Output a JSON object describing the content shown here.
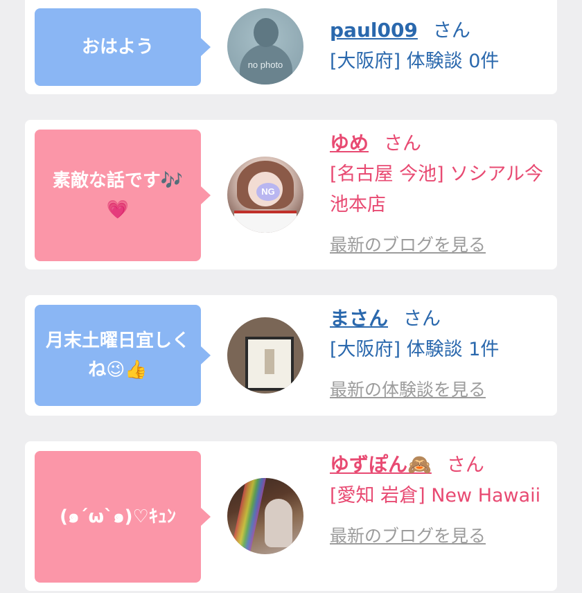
{
  "posts": [
    {
      "message": "おはよう",
      "user": "paul009",
      "suffix": "さん",
      "detail": "[大阪府] 体験談 0件",
      "link": "",
      "avatar_text": "no photo",
      "theme": "blue"
    },
    {
      "message": "素敵な話です🎶💗",
      "user": "ゆめ",
      "suffix": "さん",
      "detail": "[名古屋 今池] ソシアル今池本店",
      "link": "最新のブログを見る",
      "avatar_text": "NG",
      "theme": "pink"
    },
    {
      "message": "月末土曜日宜しくね😉👍",
      "user": "まさん",
      "suffix": "さん",
      "detail": "[大阪府] 体験談 1件",
      "link": "最新の体験談を見る",
      "avatar_text": "",
      "theme": "blue"
    },
    {
      "message": "(๑´ω`๑)♡ｷｭﾝ",
      "user": "ゆずぽん🙈",
      "suffix": "さん",
      "detail": "[愛知 岩倉] New Hawaii",
      "link": "最新のブログを見る",
      "avatar_text": "",
      "theme": "pink"
    }
  ],
  "colors": {
    "blue_bubble": "#8ab6f4",
    "pink_bubble": "#fb96a8",
    "blue_text": "#2a68ad",
    "pink_text": "#e84a72",
    "link_gray": "#9c9c9c"
  }
}
